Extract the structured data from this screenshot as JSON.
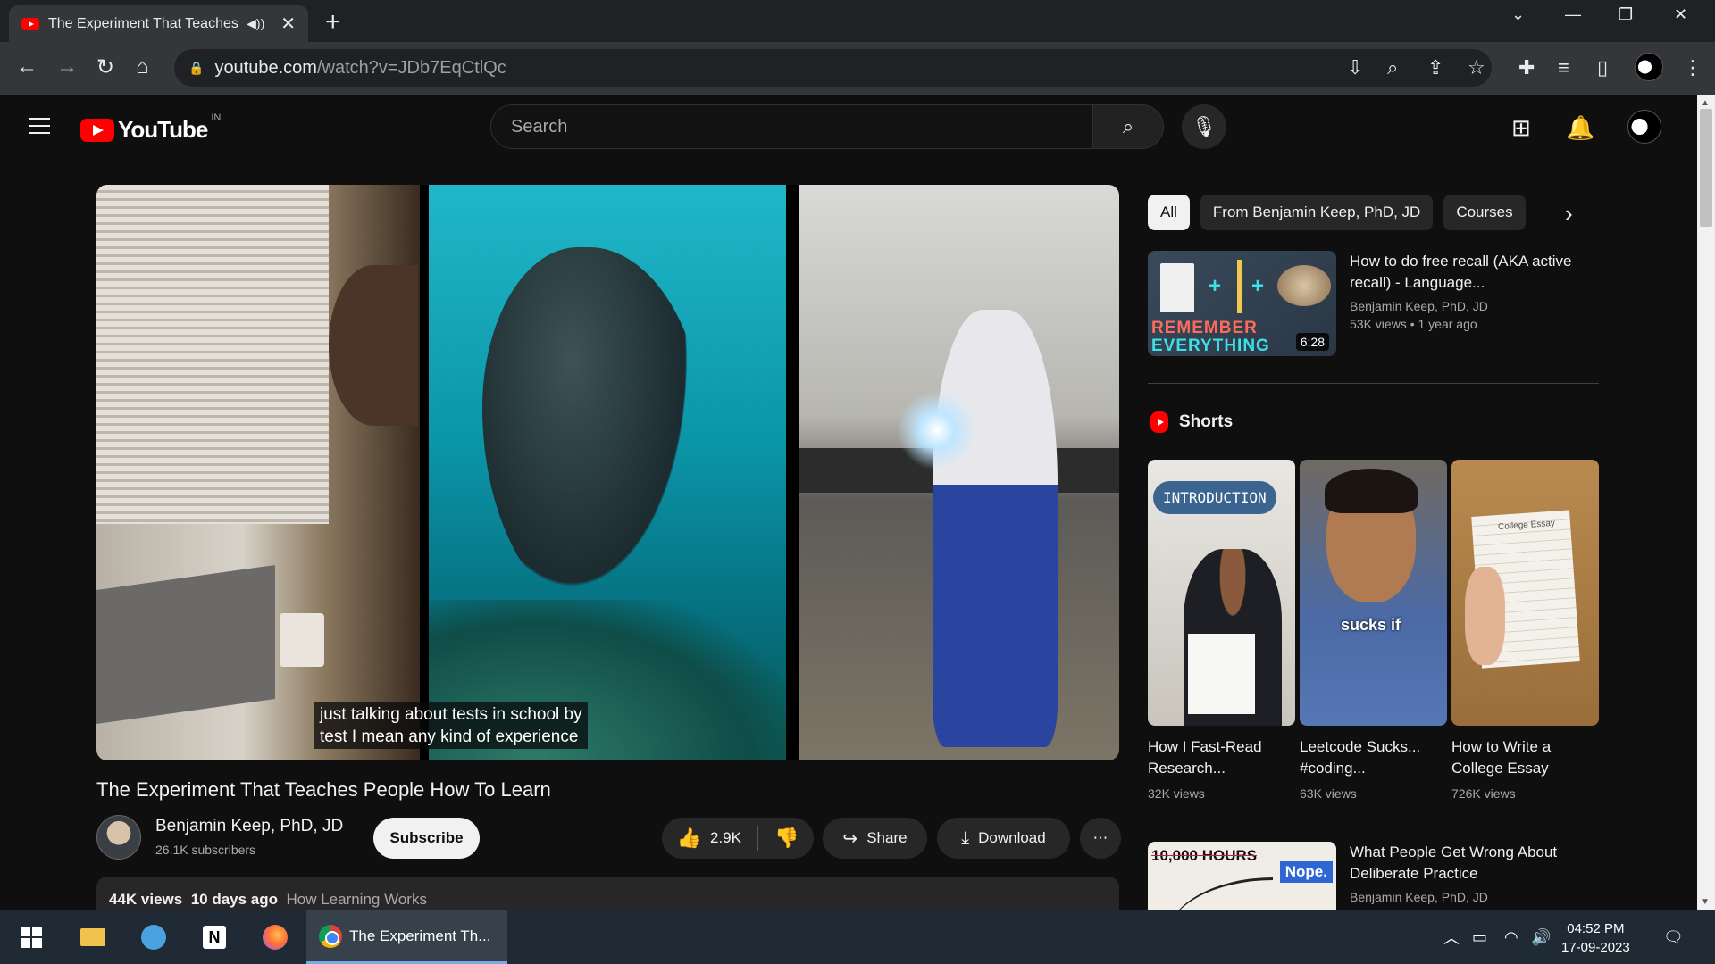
{
  "browser": {
    "tab_title": "The Experiment That Teaches",
    "url_host": "youtube.com",
    "url_path": "/watch?v=JDb7EqCtlQc"
  },
  "youtube": {
    "logo_text": "YouTube",
    "country_code": "IN",
    "search_placeholder": "Search"
  },
  "video": {
    "captions": [
      "just talking about tests in school by",
      "test I mean any kind of experience"
    ],
    "title": "The Experiment That Teaches People How To Learn",
    "channel_name": "Benjamin Keep, PhD, JD",
    "subscribers": "26.1K subscribers",
    "subscribe_label": "Subscribe",
    "likes": "2.9K",
    "share_label": "Share",
    "download_label": "Download",
    "views": "44K views",
    "age": "10 days ago",
    "hashtag": "How Learning Works"
  },
  "sidebar": {
    "chips": [
      "All",
      "From Benjamin Keep, PhD, JD",
      "Courses"
    ],
    "rec1": {
      "title": "How to do free recall (AKA active recall) - Language...",
      "channel": "Benjamin Keep, PhD, JD",
      "views": "53K views",
      "age": "1 year ago",
      "duration": "6:28",
      "thumb_line1": "REMEMBER",
      "thumb_line2": "EVERYTHING"
    },
    "shorts_heading": "Shorts",
    "shorts": [
      {
        "title": "How I Fast-Read Research...",
        "views": "32K views",
        "badge": "INTRODUCTION"
      },
      {
        "title": "Leetcode Sucks... #coding...",
        "views": "63K views",
        "overlay": "sucks if"
      },
      {
        "title": "How to Write a College Essay",
        "views": "726K views",
        "overlay": "College Essay"
      }
    ],
    "rec2": {
      "title": "What People Get Wrong About Deliberate Practice",
      "channel": "Benjamin Keep, PhD, JD",
      "thumb_text": "10,000 HOURS",
      "thumb_badge": "Nope."
    }
  },
  "taskbar": {
    "chrome_label": "The Experiment Th...",
    "time": "04:52 PM",
    "date": "17-09-2023"
  },
  "colors": {
    "yt_red": "#ff0000",
    "background": "#0f0f0f",
    "chip_bg": "#272727"
  }
}
